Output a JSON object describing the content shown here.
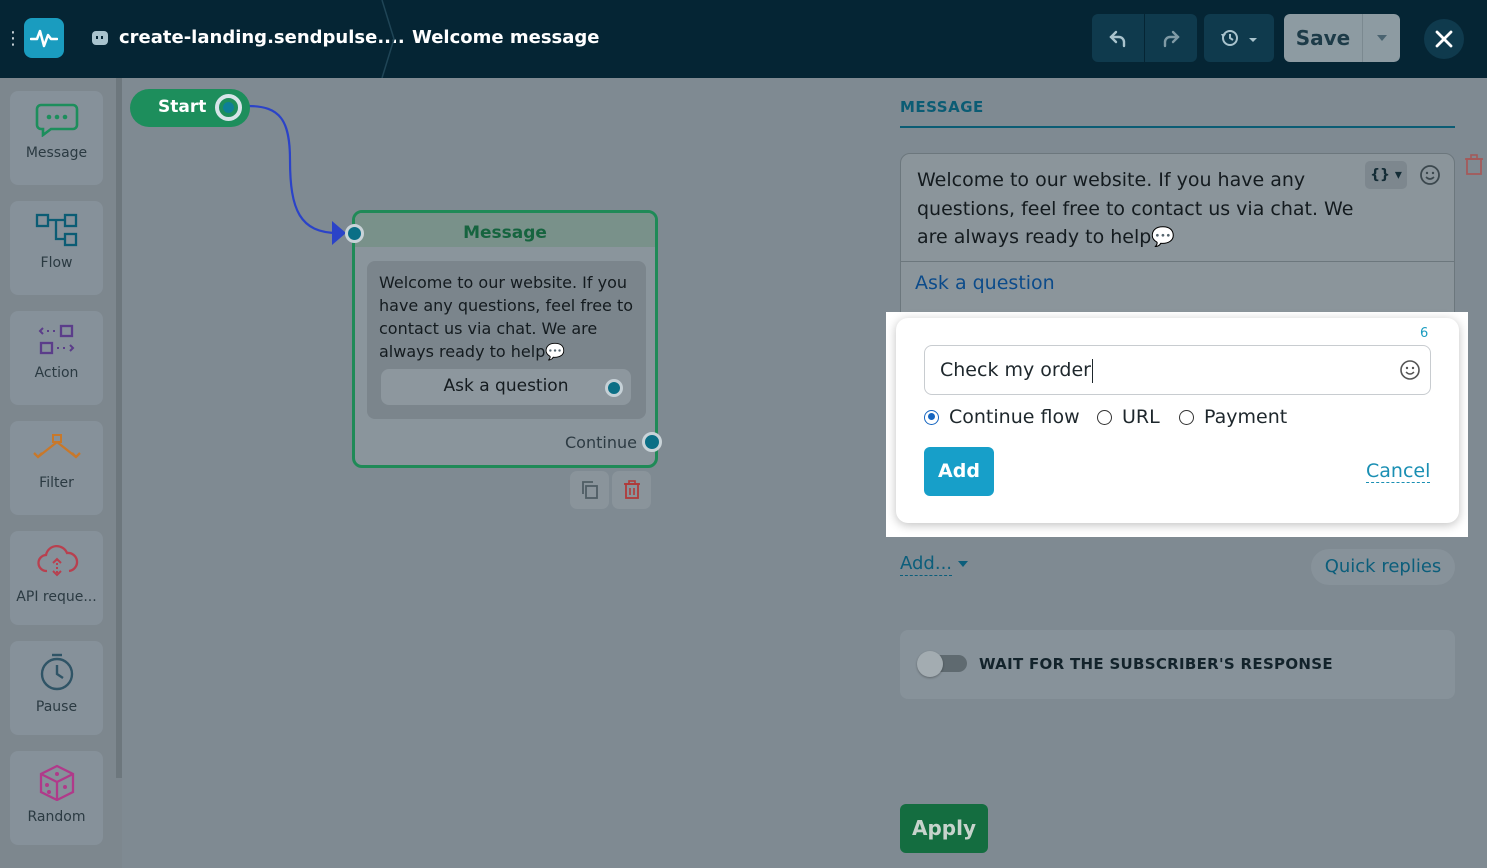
{
  "header": {
    "site_name": "create-landing.sendpulse....",
    "flow_name": "Welcome message",
    "save_label": "Save"
  },
  "palette": {
    "items": [
      {
        "label": "Message",
        "icon": "chat-bubble-icon",
        "color": "#1d8e5c"
      },
      {
        "label": "Flow",
        "icon": "flow-icon",
        "color": "#0b5c74"
      },
      {
        "label": "Action",
        "icon": "action-icon",
        "color": "#5b3d8a"
      },
      {
        "label": "Filter",
        "icon": "filter-icon",
        "color": "#c8782a"
      },
      {
        "label": "API reque...",
        "icon": "api-cloud-icon",
        "color": "#b8404f"
      },
      {
        "label": "Pause",
        "icon": "clock-icon",
        "color": "#2f5466"
      },
      {
        "label": "Random",
        "icon": "dice-icon",
        "color": "#b03a8a"
      }
    ]
  },
  "canvas": {
    "start_label": "Start",
    "message_node": {
      "title": "Message",
      "text": "Welcome to our website. If you have any questions, feel free to contact us via chat. We are always ready to help💬",
      "button_label": "Ask a question",
      "continue_label": "Continue"
    }
  },
  "panel": {
    "tab_label": "MESSAGE",
    "message_text": "Welcome to our website. If you have any questions, feel free to contact us via chat. We are always ready to help💬",
    "existing_button": "Ask a question",
    "var_label": "{}",
    "popup": {
      "char_count": "6",
      "input_value": "Check my order",
      "options": [
        {
          "label": "Continue flow",
          "selected": true
        },
        {
          "label": "URL",
          "selected": false
        },
        {
          "label": "Payment",
          "selected": false
        }
      ],
      "add_label": "Add",
      "cancel_label": "Cancel"
    },
    "add_menu_label": "Add...",
    "quick_replies_label": "Quick replies",
    "wait_label": "WAIT FOR THE SUBSCRIBER'S RESPONSE",
    "apply_label": "Apply"
  },
  "colors": {
    "topbar": "#052534",
    "accent": "#179fc9",
    "green": "#1d8e5c"
  }
}
